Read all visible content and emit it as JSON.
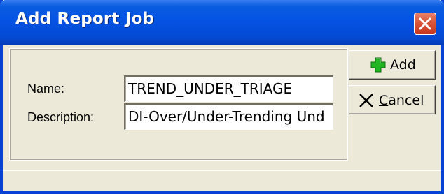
{
  "window": {
    "title": "Add Report Job",
    "close_label": "Close"
  },
  "form": {
    "name_label": "Name:",
    "name_value": "TREND_UNDER_TRIAGE",
    "description_label": "Description:",
    "description_value": "DI-Over/Under-Trending Und"
  },
  "buttons": {
    "add_mnemonic": "A",
    "add_rest": "dd",
    "add_icon": "green-plus-icon",
    "cancel_mnemonic": "C",
    "cancel_rest": "ancel",
    "cancel_icon": "x-icon"
  },
  "colors": {
    "title_bar": "#0553e4",
    "dialog_face": "#ece9d8",
    "close_button": "#d8553a",
    "add_icon": "#22b522"
  }
}
